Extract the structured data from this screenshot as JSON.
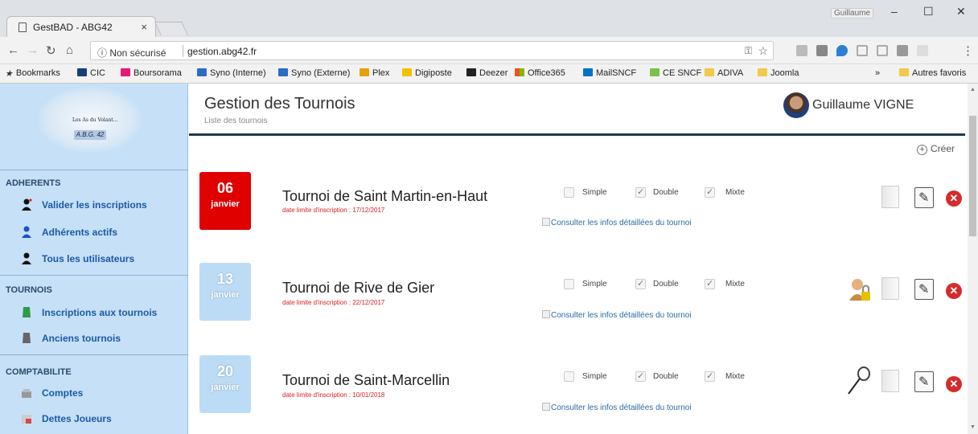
{
  "browser": {
    "tab_title": "GestBAD - ABG42",
    "tab_close": "×",
    "window_user": "Guillaume",
    "security_label": "ⓘ Non sécurisé",
    "url": "gestion.abg42.fr",
    "bookmarks": [
      "Bookmarks",
      "CIC",
      "Boursorama",
      "Syno (Interne)",
      "Syno (Externe)",
      "Plex",
      "Digiposte",
      "Deezer",
      "Office365",
      "MailSNCF",
      "CE SNCF",
      "ADIVA",
      "Joomla"
    ],
    "bookmarks_more": "»",
    "other_bookmarks": "Autres favoris"
  },
  "sidebar": {
    "logo_text": "Les As du Volant...",
    "logo_badge": "A.B.G. 42",
    "sections": [
      {
        "title": "ADHERENTS",
        "items": [
          "Valider les inscriptions",
          "Adhérents actifs",
          "Tous les utilisateurs"
        ]
      },
      {
        "title": "TOURNOIS",
        "items": [
          "Inscriptions aux tournois",
          "Anciens tournois"
        ]
      },
      {
        "title": "COMPTABILITE",
        "items": [
          "Comptes",
          "Dettes Joueurs"
        ]
      }
    ]
  },
  "header": {
    "title": "Gestion des Tournois",
    "subtitle": "Liste des tournois",
    "user_name": "Guillaume VIGNE",
    "create_label": "Créer",
    "create_symbol": "+"
  },
  "tournaments": [
    {
      "day": "06",
      "month": "janvier",
      "name": "Tournoi de Saint Martin-en-Haut",
      "deadline": "date limite d'inscription : 17/12/2017",
      "simple": "Simple",
      "double": "Double",
      "mixte": "Mixte",
      "info_link": "Consulter les infos détaillées du tournoi",
      "date_color": "#e00000"
    },
    {
      "day": "13",
      "month": "janvier",
      "name": "Tournoi de Rive de Gier",
      "deadline": "date limite d'inscription : 22/12/2017",
      "simple": "Simple",
      "double": "Double",
      "mixte": "Mixte",
      "info_link": "Consulter les infos détaillées du tournoi",
      "date_color": "#bcdcf6"
    },
    {
      "day": "20",
      "month": "janvier",
      "name": "Tournoi de Saint-Marcellin",
      "deadline": "date limite d'inscription : 10/01/2018",
      "simple": "Simple",
      "double": "Double",
      "mixte": "Mixte",
      "info_link": "Consulter les infos détaillées du tournoi",
      "date_color": "#bcdcf6"
    }
  ],
  "icons": {
    "delete": "✕"
  }
}
